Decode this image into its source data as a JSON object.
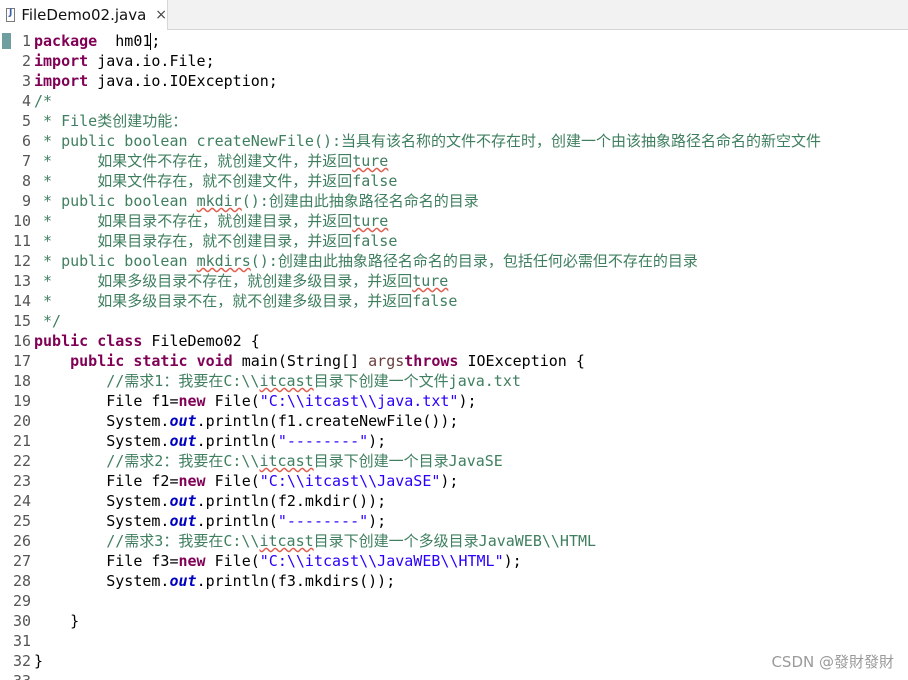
{
  "tab": {
    "label": "FileDemo02.java",
    "icon": "java-file-icon",
    "close": "×"
  },
  "line_numbers": [
    "1",
    "2",
    "3",
    "4",
    "5",
    "6",
    "7",
    "8",
    "9",
    "10",
    "11",
    "12",
    "13",
    "14",
    "15",
    "16",
    "17",
    "18",
    "19",
    "20",
    "21",
    "22",
    "23",
    "24",
    "25",
    "26",
    "27",
    "28",
    "29",
    "30",
    "31",
    "32",
    "33"
  ],
  "lines": [
    [
      [
        "kw",
        "package"
      ],
      [
        "",
        "  hm01;"
      ]
    ],
    [
      [
        "kw",
        "import"
      ],
      [
        "",
        " java.io.File;"
      ]
    ],
    [
      [
        "kw",
        "import"
      ],
      [
        "",
        " java.io.IOException;"
      ]
    ],
    [
      [
        "cm",
        "/*"
      ]
    ],
    [
      [
        "cm",
        " * File类创建功能："
      ]
    ],
    [
      [
        "cm",
        " * public boolean createNewFile():当具有该名称的文件不存在时，创建一个由该抽象路径名命名的新空文件"
      ]
    ],
    [
      [
        "cm",
        " *     如果文件不存在，就创建文件，并返回"
      ],
      [
        "cm sq",
        "ture"
      ]
    ],
    [
      [
        "cm",
        " *     如果文件存在，就不创建文件，并返回false"
      ]
    ],
    [
      [
        "cm",
        " * public boolean "
      ],
      [
        "cm sq",
        "mkdir"
      ],
      [
        "cm",
        "():创建由此抽象路径名命名的目录"
      ]
    ],
    [
      [
        "cm",
        " *     如果目录不存在，就创建目录，并返回"
      ],
      [
        "cm sq",
        "ture"
      ]
    ],
    [
      [
        "cm",
        " *     如果目录存在，就不创建目录，并返回false"
      ]
    ],
    [
      [
        "cm",
        " * public boolean "
      ],
      [
        "cm sq",
        "mkdirs"
      ],
      [
        "cm",
        "():创建由此抽象路径名命名的目录，包括任何必需但不存在的目录"
      ]
    ],
    [
      [
        "cm",
        " *     如果多级目录不存在，就创建多级目录，并返回"
      ],
      [
        "cm sq",
        "ture"
      ]
    ],
    [
      [
        "cm",
        " *     如果多级目录不在，就不创建多级目录，并返回false"
      ]
    ],
    [
      [
        "cm",
        " */"
      ]
    ],
    [
      [
        "kw",
        "public"
      ],
      [
        "",
        " "
      ],
      [
        "kw",
        "class"
      ],
      [
        "",
        " FileDemo02 {"
      ]
    ],
    [
      [
        "",
        "    "
      ],
      [
        "kw",
        "public"
      ],
      [
        "",
        " "
      ],
      [
        "kw",
        "static"
      ],
      [
        "",
        " "
      ],
      [
        "kw",
        "void"
      ],
      [
        "",
        " main(String[] "
      ],
      [
        "pr",
        "args"
      ],
      [
        ") "
      ],
      [
        "kw",
        "throws"
      ],
      [
        "",
        " IOException {"
      ]
    ],
    [
      [
        "",
        "        "
      ],
      [
        "cm",
        "//需求1：我要在C:\\\\"
      ],
      [
        "cm sq",
        "itcast"
      ],
      [
        "cm",
        "目录下创建一个文件java.txt"
      ]
    ],
    [
      [
        "",
        "        File f1="
      ],
      [
        "kw",
        "new"
      ],
      [
        "",
        " File("
      ],
      [
        "st",
        "\"C:\\\\itcast\\\\java.txt\""
      ],
      [
        "",
        ");"
      ]
    ],
    [
      [
        "",
        "        System."
      ],
      [
        "fld",
        "out"
      ],
      [
        "",
        ".println(f1.createNewFile());"
      ]
    ],
    [
      [
        "",
        "        System."
      ],
      [
        "fld",
        "out"
      ],
      [
        "",
        ".println("
      ],
      [
        "st",
        "\"--------\""
      ],
      [
        "",
        ");"
      ]
    ],
    [
      [
        "",
        "        "
      ],
      [
        "cm",
        "//需求2：我要在C:\\\\"
      ],
      [
        "cm sq",
        "itcast"
      ],
      [
        "cm",
        "目录下创建一个目录JavaSE"
      ]
    ],
    [
      [
        "",
        "        File f2="
      ],
      [
        "kw",
        "new"
      ],
      [
        "",
        " File("
      ],
      [
        "st",
        "\"C:\\\\itcast\\\\JavaSE\""
      ],
      [
        "",
        ");"
      ]
    ],
    [
      [
        "",
        "        System."
      ],
      [
        "fld",
        "out"
      ],
      [
        "",
        ".println(f2.mkdir());"
      ]
    ],
    [
      [
        "",
        "        System."
      ],
      [
        "fld",
        "out"
      ],
      [
        "",
        ".println("
      ],
      [
        "st",
        "\"--------\""
      ],
      [
        "",
        ");"
      ]
    ],
    [
      [
        "",
        "        "
      ],
      [
        "cm",
        "//需求3：我要在C:\\\\"
      ],
      [
        "cm sq",
        "itcast"
      ],
      [
        "cm",
        "目录下创建一个多级目录JavaWEB\\\\HTML"
      ]
    ],
    [
      [
        "",
        "        File f3="
      ],
      [
        "kw",
        "new"
      ],
      [
        "",
        " File("
      ],
      [
        "st",
        "\"C:\\\\itcast\\\\JavaWEB\\\\HTML\""
      ],
      [
        "",
        ");"
      ]
    ],
    [
      [
        "",
        "        System."
      ],
      [
        "fld",
        "out"
      ],
      [
        "",
        ".println(f3.mkdirs());"
      ]
    ],
    [],
    [
      [
        "",
        "    }"
      ]
    ],
    [],
    [
      [
        "",
        "}"
      ]
    ],
    []
  ],
  "watermark": "CSDN @發財發財"
}
